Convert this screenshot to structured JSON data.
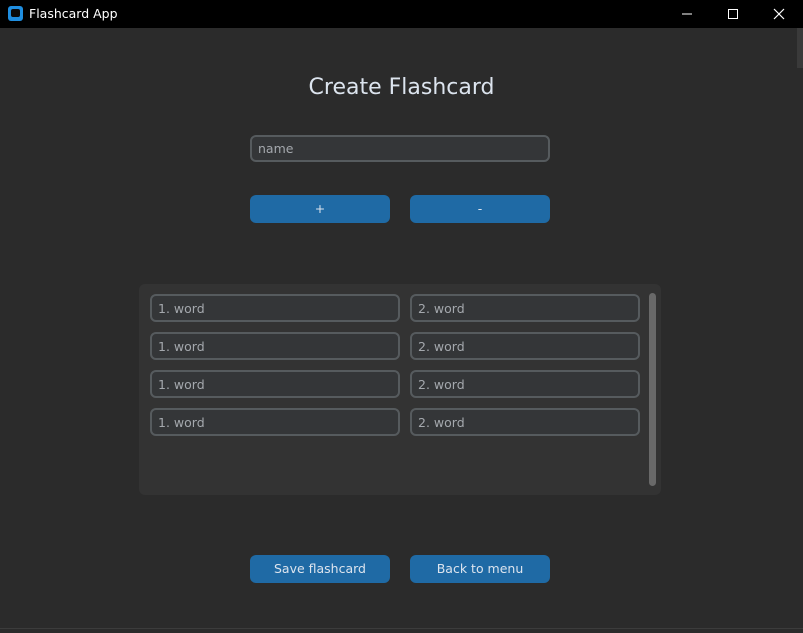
{
  "window": {
    "title": "Flashcard App",
    "icon": "app-icon"
  },
  "page": {
    "heading": "Create Flashcard",
    "name_placeholder": "name",
    "add_button": "+",
    "remove_button": "-",
    "save_button": "Save flashcard",
    "back_button": "Back to menu"
  },
  "pairs": [
    {
      "word1_placeholder": "1. word",
      "word2_placeholder": "2. word"
    },
    {
      "word1_placeholder": "1. word",
      "word2_placeholder": "2. word"
    },
    {
      "word1_placeholder": "1. word",
      "word2_placeholder": "2. word"
    },
    {
      "word1_placeholder": "1. word",
      "word2_placeholder": "2. word"
    }
  ],
  "colors": {
    "background": "#2b2b2b",
    "button": "#1f6aa5",
    "input_bg": "#343638",
    "input_border": "#565b5e",
    "text": "#dce4ee"
  }
}
